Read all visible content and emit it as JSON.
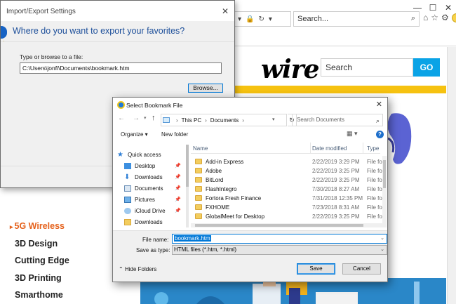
{
  "browser": {
    "search_placeholder": "Search...",
    "window_controls": [
      "—",
      "☐",
      "✕"
    ]
  },
  "site": {
    "logo_fragment": "wire",
    "search_placeholder": "Search",
    "go_label": "GO",
    "nav": [
      {
        "label": "5G Wireless",
        "active": true
      },
      {
        "label": "3D Design",
        "active": false
      },
      {
        "label": "Cutting Edge",
        "active": false
      },
      {
        "label": "3D Printing",
        "active": false
      },
      {
        "label": "Smarthome",
        "active": false
      }
    ],
    "colors": {
      "accent_yellow": "#f6c210",
      "go_blue": "#0aa3e6",
      "active_nav": "#e5611b"
    }
  },
  "import_dialog": {
    "title": "Import/Export Settings",
    "question": "Where do you want to export your favorites?",
    "field_label": "Type or browse to a file:",
    "path_value": "C:\\Users\\jonfi\\Documents\\bookmark.htm",
    "browse_label": "Browse..."
  },
  "file_dialog": {
    "title": "Select Bookmark File",
    "breadcrumb": [
      "This PC",
      "Documents"
    ],
    "search_placeholder": "Search Documents",
    "organize_label": "Organize ▾",
    "new_folder_label": "New folder",
    "nav_items": [
      {
        "label": "Quick access",
        "icon": "star-icon",
        "pinned": false
      },
      {
        "label": "Desktop",
        "icon": "desktop-icon",
        "pinned": true
      },
      {
        "label": "Downloads",
        "icon": "downloads-icon",
        "pinned": true
      },
      {
        "label": "Documents",
        "icon": "documents-icon",
        "pinned": true
      },
      {
        "label": "Pictures",
        "icon": "pictures-icon",
        "pinned": true
      },
      {
        "label": "iCloud Drive",
        "icon": "cloud-icon",
        "pinned": true
      },
      {
        "label": "Downloads",
        "icon": "folder-icon",
        "pinned": false
      }
    ],
    "columns": {
      "name": "Name",
      "date": "Date modified",
      "type": "Type"
    },
    "files": [
      {
        "name": "Add-in Express",
        "date": "2/22/2019 3:29 PM",
        "type": "File fol"
      },
      {
        "name": "Adobe",
        "date": "2/22/2019 3:25 PM",
        "type": "File fol"
      },
      {
        "name": "BitLord",
        "date": "2/22/2019 3:25 PM",
        "type": "File fol"
      },
      {
        "name": "FlashIntegro",
        "date": "7/30/2018 8:27 AM",
        "type": "File fol"
      },
      {
        "name": "Fortora Fresh Finance",
        "date": "7/31/2018 12:35 PM",
        "type": "File fol"
      },
      {
        "name": "FXHOME",
        "date": "7/23/2018 8:31 AM",
        "type": "File fol"
      },
      {
        "name": "GlobalMeet for Desktop",
        "date": "2/22/2019 3:25 PM",
        "type": "File fol"
      }
    ],
    "file_name_label": "File name:",
    "file_name_value": "bookmark.htm",
    "save_type_label": "Save as type:",
    "save_type_value": "HTML files (*.htm, *.html)",
    "hide_folders_label": "Hide Folders",
    "save_label": "Save",
    "cancel_label": "Cancel"
  }
}
